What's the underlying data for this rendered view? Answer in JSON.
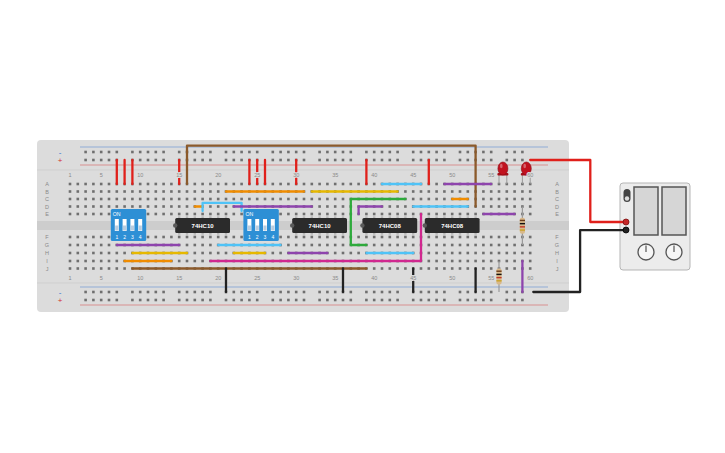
{
  "breadboard": {
    "rails": [
      {
        "label": "-",
        "color": "#2f6fd0"
      },
      {
        "label": "+",
        "color": "#d32f2f"
      },
      {
        "label": "-",
        "color": "#2f6fd0"
      },
      {
        "label": "+",
        "color": "#d32f2f"
      }
    ],
    "column_labels": [
      "1",
      "5",
      "10",
      "15",
      "20",
      "25",
      "30",
      "35",
      "40",
      "45",
      "50",
      "55",
      "60"
    ],
    "row_labels": [
      "A",
      "B",
      "C",
      "D",
      "E",
      "F",
      "G",
      "H",
      "I",
      "J"
    ]
  },
  "switches": [
    {
      "label": "ON",
      "col": 7,
      "keys": [
        {
          "label": "1",
          "on": false
        },
        {
          "label": "2",
          "on": false
        },
        {
          "label": "3",
          "on": false
        },
        {
          "label": "4",
          "on": false
        }
      ]
    },
    {
      "label": "ON",
      "col": 24,
      "keys": [
        {
          "label": "1",
          "on": false
        },
        {
          "label": "2",
          "on": false
        },
        {
          "label": "3",
          "on": false
        },
        {
          "label": "4",
          "on": false
        }
      ]
    }
  ],
  "chips": [
    {
      "label": "74HC10",
      "col": 15
    },
    {
      "label": "74HC10",
      "col": 30
    },
    {
      "label": "74HC08",
      "col": 39
    },
    {
      "label": "74HC08",
      "col": 47
    }
  ],
  "leds": [
    {
      "col": 56,
      "lit": false
    },
    {
      "col": 59,
      "lit": false
    }
  ],
  "resistors": [
    {
      "col": 59,
      "from": 5,
      "to": 8
    },
    {
      "col": 56,
      "from": 10,
      "to": 12
    }
  ],
  "wires": [
    {
      "color": "#e0201b",
      "points": [
        [
          7,
          1
        ],
        [
          7,
          2
        ]
      ]
    },
    {
      "color": "#e0201b",
      "points": [
        [
          8,
          1
        ],
        [
          8,
          2
        ]
      ]
    },
    {
      "color": "#e0201b",
      "points": [
        [
          9,
          1
        ],
        [
          9,
          2
        ]
      ]
    },
    {
      "color": "#e0201b",
      "points": [
        [
          15,
          1
        ],
        [
          15,
          2
        ]
      ]
    },
    {
      "color": "#e0201b",
      "points": [
        [
          24,
          1
        ],
        [
          24,
          2
        ]
      ]
    },
    {
      "color": "#e0201b",
      "points": [
        [
          25,
          1
        ],
        [
          25,
          2
        ]
      ]
    },
    {
      "color": "#e0201b",
      "points": [
        [
          26,
          1
        ],
        [
          26,
          2
        ]
      ]
    },
    {
      "color": "#e0201b",
      "points": [
        [
          30,
          1
        ],
        [
          30,
          2
        ]
      ]
    },
    {
      "color": "#e0201b",
      "points": [
        [
          39,
          1
        ],
        [
          39,
          2
        ]
      ]
    },
    {
      "color": "#e0201b",
      "points": [
        [
          47,
          1
        ],
        [
          47,
          2
        ]
      ]
    },
    {
      "color": "#8b5a2b",
      "points": [
        [
          16,
          2
        ],
        [
          16,
          -0.8
        ],
        [
          53,
          -0.8
        ],
        [
          53,
          5
        ]
      ]
    },
    {
      "color": "#f08c00",
      "points": [
        [
          21,
          3
        ],
        [
          31,
          3
        ]
      ]
    },
    {
      "color": "#f08c00",
      "points": [
        [
          17,
          5
        ],
        [
          18,
          5
        ]
      ]
    },
    {
      "color": "#e6b800",
      "points": [
        [
          32,
          3
        ],
        [
          43,
          3
        ]
      ]
    },
    {
      "color": "#4fc3f7",
      "points": [
        [
          41,
          2
        ],
        [
          46,
          2
        ]
      ]
    },
    {
      "color": "#8e44ad",
      "points": [
        [
          49,
          2
        ],
        [
          55,
          2
        ]
      ]
    },
    {
      "color": "#4fc3f7",
      "points": [
        [
          18,
          5.6
        ],
        [
          18,
          4.5
        ],
        [
          23,
          4.5
        ],
        [
          23,
          5.6
        ]
      ]
    },
    {
      "color": "#8e44ad",
      "points": [
        [
          22,
          5
        ],
        [
          32,
          5
        ]
      ]
    },
    {
      "color": "#2eaa3c",
      "points": [
        [
          44,
          4
        ],
        [
          37,
          4
        ],
        [
          37,
          8
        ],
        [
          39,
          8
        ]
      ]
    },
    {
      "color": "#8e44ad",
      "points": [
        [
          38,
          6
        ],
        [
          38,
          5
        ],
        [
          41,
          5
        ]
      ]
    },
    {
      "color": "#d0288f",
      "points": [
        [
          19,
          10
        ],
        [
          46,
          10
        ],
        [
          46,
          6
        ]
      ]
    },
    {
      "color": "#4fc3f7",
      "points": [
        [
          45,
          5
        ],
        [
          52,
          5
        ]
      ]
    },
    {
      "color": "#f08c00",
      "points": [
        [
          50,
          4
        ],
        [
          52,
          4
        ]
      ]
    },
    {
      "color": "#8e44ad",
      "points": [
        [
          54,
          6
        ],
        [
          58,
          6
        ]
      ]
    },
    {
      "color": "#8e44ad",
      "points": [
        [
          59,
          10
        ],
        [
          59,
          12
        ]
      ]
    },
    {
      "color": "#8e44ad",
      "points": [
        [
          7,
          8
        ],
        [
          15,
          8
        ]
      ]
    },
    {
      "color": "#e6b800",
      "points": [
        [
          9,
          9
        ],
        [
          16,
          9
        ]
      ]
    },
    {
      "color": "#4fc3f7",
      "points": [
        [
          20,
          8
        ],
        [
          28,
          8
        ]
      ]
    },
    {
      "color": "#e6b800",
      "points": [
        [
          22,
          9
        ],
        [
          26,
          9
        ]
      ]
    },
    {
      "color": "#8e44ad",
      "points": [
        [
          29,
          9
        ],
        [
          34,
          9
        ]
      ]
    },
    {
      "color": "#f08c00",
      "points": [
        [
          8,
          10
        ],
        [
          14,
          10
        ]
      ]
    },
    {
      "color": "#8b5a2b",
      "points": [
        [
          9,
          11
        ],
        [
          39,
          11
        ]
      ]
    },
    {
      "color": "#4fc3f7",
      "points": [
        [
          39,
          9
        ],
        [
          45,
          9
        ]
      ]
    },
    {
      "color": "#222222",
      "points": [
        [
          21,
          11
        ],
        [
          21,
          12
        ]
      ]
    },
    {
      "color": "#222222",
      "points": [
        [
          36,
          11
        ],
        [
          36,
          12
        ]
      ]
    },
    {
      "color": "#222222",
      "points": [
        [
          45,
          11
        ],
        [
          45,
          12
        ]
      ]
    },
    {
      "color": "#222222",
      "points": [
        [
          53,
          11
        ],
        [
          53,
          12
        ]
      ]
    },
    {
      "color": "#e0201b",
      "points": [
        [
          60,
          1
        ],
        [
          67.7,
          1
        ],
        [
          67.7,
          6.35
        ],
        [
          72.3,
          6.35
        ]
      ]
    },
    {
      "color": "#222222",
      "points": [
        [
          60.4,
          12
        ],
        [
          66.4,
          12
        ],
        [
          66.4,
          6.7
        ],
        [
          72.3,
          6.7
        ]
      ]
    }
  ],
  "power_supply": {
    "on": false
  }
}
